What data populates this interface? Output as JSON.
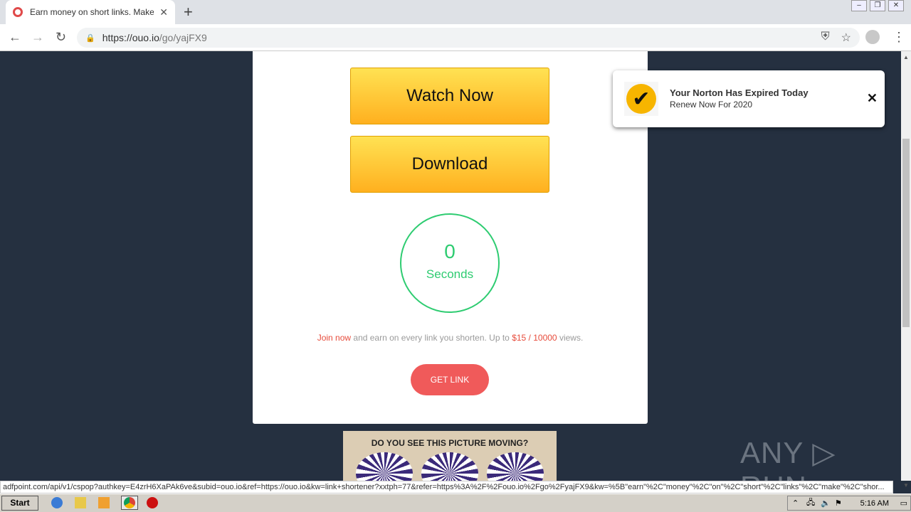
{
  "browser": {
    "tab_title": "Earn money on short links. Make sho",
    "url_host": "https://ouo.io",
    "url_path": "/go/yajFX9",
    "new_tab": "+"
  },
  "page": {
    "watch_label": "Watch Now",
    "download_label": "Download",
    "countdown": "0",
    "countdown_unit": "Seconds",
    "promo_join": "Join now",
    "promo_mid": " and earn on every link you shorten. Up to ",
    "promo_rate": "$15 / 10000",
    "promo_end": " views.",
    "get_link": "GET LINK"
  },
  "ad": {
    "title": "DO YOU SEE THIS PICTURE MOVING?"
  },
  "notification": {
    "title": "Your Norton Has Expired Today",
    "subtitle": "Renew Now For 2020",
    "close": "✕"
  },
  "watermark": "ANY ▷ RUN",
  "statusbar": "adfpoint.com/api/v1/cspop?authkey=E4zrH6XaPAk6ve&subid=ouo.io&ref=https://ouo.io&kw=link+shortener?xxtph=77&refer=https%3A%2F%2Fouo.io%2Fgo%2FyajFX9&kw=%5B\"earn\"%2C\"money\"%2C\"on\"%2C\"short\"%2C\"links\"%2C\"make\"%2C\"shor...",
  "taskbar": {
    "start": "Start",
    "clock": "5:16 AM"
  }
}
